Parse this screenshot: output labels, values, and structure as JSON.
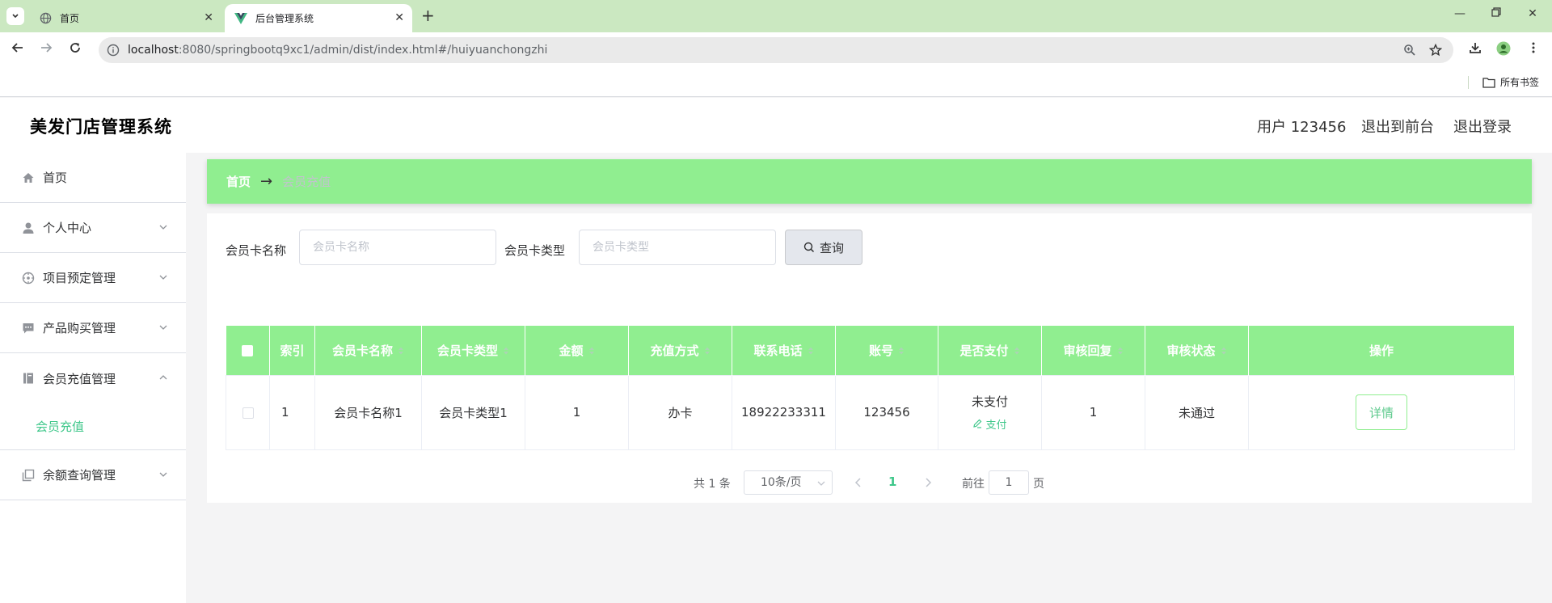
{
  "browser": {
    "tabs": [
      {
        "title": "首页"
      },
      {
        "title": "后台管理系统"
      }
    ],
    "url_host": "localhost",
    "url_path": ":8080/springbootq9xc1/admin/dist/index.html#/huiyuanchongzhi",
    "bookmarks_label": "所有书签"
  },
  "header": {
    "title": "美发门店管理系统",
    "user": "用户 123456",
    "to_front": "退出到前台",
    "logout": "退出登录"
  },
  "sidebar": {
    "items": [
      {
        "label": "首页"
      },
      {
        "label": "个人中心"
      },
      {
        "label": "项目预定管理"
      },
      {
        "label": "产品购买管理"
      },
      {
        "label": "会员充值管理"
      },
      {
        "label": "余额查询管理"
      }
    ],
    "submenu": "会员充值"
  },
  "breadcrumb": {
    "home": "首页",
    "separator": "→",
    "current": "会员充值"
  },
  "search": {
    "name_label": "会员卡名称",
    "name_placeholder": "会员卡名称",
    "type_label": "会员卡类型",
    "type_placeholder": "会员卡类型",
    "button": "查询"
  },
  "table": {
    "columns": [
      "索引",
      "会员卡名称",
      "会员卡类型",
      "金额",
      "充值方式",
      "联系电话",
      "账号",
      "是否支付",
      "审核回复",
      "审核状态",
      "操作"
    ],
    "rows": [
      {
        "index": "1",
        "card_name": "会员卡名称1",
        "card_type": "会员卡类型1",
        "amount": "1",
        "method": "办卡",
        "phone": "18922233311",
        "account": "123456",
        "paid": "未支付",
        "pay_action": "支付",
        "reply": "1",
        "status": "未通过",
        "detail": "详情"
      }
    ]
  },
  "pagination": {
    "total": "共 1 条",
    "page_size": "10条/页",
    "current": "1",
    "goto_label": "前往",
    "goto_value": "1",
    "page_suffix": "页"
  },
  "colors": {
    "accent": "#90ee90",
    "link": "#3ec78a",
    "tabbar": "#cbe8c1"
  }
}
